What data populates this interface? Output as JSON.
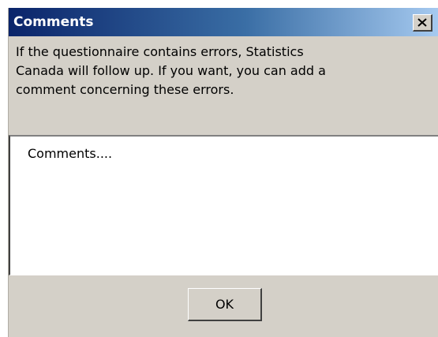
{
  "window": {
    "title": "Comments",
    "close_icon": "close-icon",
    "close_glyph": "X"
  },
  "message": {
    "lines": [
      "If the questionnaire contains errors, Statistics",
      "Canada will follow up.  If you want, you can add a",
      "comment concerning these errors."
    ]
  },
  "comment_field": {
    "value": "",
    "placeholder": "Comments...."
  },
  "buttons": {
    "ok_label": "OK"
  },
  "colors": {
    "dialog_background": "#d4d0c8",
    "titlebar_start": "#0a246a",
    "titlebar_end": "#a6caf0",
    "title_text": "#ffffff"
  }
}
